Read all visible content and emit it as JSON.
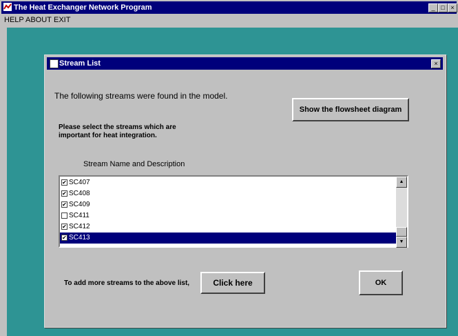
{
  "app": {
    "title": "The Heat Exchanger Network Program",
    "controls": {
      "minimize": "_",
      "maximize": "□",
      "close": "×"
    }
  },
  "menu": [
    "HELP",
    "ABOUT",
    "EXIT"
  ],
  "dialog": {
    "title": "Stream List",
    "close": "×",
    "intro": "The following streams were found in the model.",
    "flowsheet_button": "Show the flowsheet diagram",
    "instruction_line1": "Please select the streams which are",
    "instruction_line2": "important for heat integration.",
    "column_header": "Stream Name and Description",
    "streams": [
      {
        "name": "SC407",
        "checked": true,
        "selected": false
      },
      {
        "name": "SC408",
        "checked": true,
        "selected": false
      },
      {
        "name": "SC409",
        "checked": true,
        "selected": false
      },
      {
        "name": "SC411",
        "checked": false,
        "selected": false
      },
      {
        "name": "SC412",
        "checked": true,
        "selected": false
      },
      {
        "name": "SC413",
        "checked": true,
        "selected": true
      }
    ],
    "add_text": "To add more streams to the above list,",
    "click_button": "Click here",
    "ok_button": "OK"
  },
  "colors": {
    "titlebar": "#00007b",
    "desktop": "#2e9494",
    "face": "#c0c0c0"
  }
}
